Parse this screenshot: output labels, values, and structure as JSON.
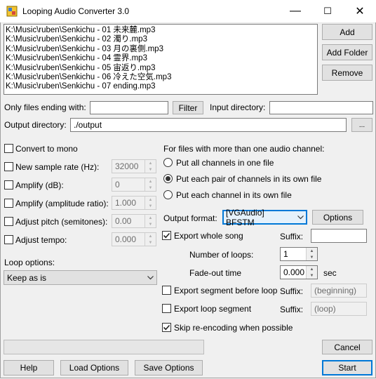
{
  "window": {
    "title": "Looping Audio Converter 3.0",
    "controls": {
      "minimize": "—",
      "maximize": "☐",
      "close": "✕"
    }
  },
  "files": [
    "K:\\Music\\ruben\\Senkichu - 01 未来麓.mp3",
    "K:\\Music\\ruben\\Senkichu - 02 濁り.mp3",
    "K:\\Music\\ruben\\Senkichu - 03 月の裏側.mp3",
    "K:\\Music\\ruben\\Senkichu - 04 霊界.mp3",
    "K:\\Music\\ruben\\Senkichu - 05 宙返り.mp3",
    "K:\\Music\\ruben\\Senkichu - 06 冷えた空気.mp3",
    "K:\\Music\\ruben\\Senkichu - 07 ending.mp3"
  ],
  "buttons": {
    "add": "Add",
    "add_folder": "Add Folder",
    "remove": "Remove",
    "filter": "Filter",
    "browse": "...",
    "options": "Options",
    "cancel": "Cancel",
    "help": "Help",
    "load_options": "Load Options",
    "save_options": "Save Options",
    "start": "Start"
  },
  "filter": {
    "label": "Only files ending with:",
    "value": "",
    "input_dir_label": "Input directory:",
    "input_dir_value": ""
  },
  "output": {
    "label": "Output directory:",
    "value": "./output"
  },
  "left_options": {
    "convert_mono": {
      "label": "Convert to mono",
      "checked": false
    },
    "sample_rate": {
      "label": "New sample rate (Hz):",
      "checked": false,
      "value": "32000"
    },
    "amplify_db": {
      "label": "Amplify (dB):",
      "checked": false,
      "value": "0"
    },
    "amplify_ratio": {
      "label": "Amplify (amplitude ratio):",
      "checked": false,
      "value": "1.000"
    },
    "pitch": {
      "label": "Adjust pitch (semitones):",
      "checked": false,
      "value": "0.00"
    },
    "tempo": {
      "label": "Adjust tempo:",
      "checked": false,
      "value": "0.000"
    }
  },
  "loop": {
    "label": "Loop options:",
    "value": "Keep as is"
  },
  "channels": {
    "label": "For files with more than one audio channel:",
    "options": [
      {
        "label": "Put all channels in one file",
        "selected": false
      },
      {
        "label": "Put each pair of channels in its own file",
        "selected": true
      },
      {
        "label": "Put each channel in its own file",
        "selected": false
      }
    ]
  },
  "format": {
    "label": "Output format:",
    "value": "[VGAudio] BFSTM"
  },
  "export_whole": {
    "label": "Export whole song",
    "checked": true,
    "suffix_label": "Suffix:",
    "suffix_value": ""
  },
  "loops": {
    "label": "Number of loops:",
    "value": "1"
  },
  "fade": {
    "label": "Fade-out time",
    "value": "0.000",
    "unit": "sec"
  },
  "export_before": {
    "label": "Export segment before loop",
    "checked": false,
    "suffix_label": "Suffix:",
    "suffix_value": "(beginning)"
  },
  "export_loop": {
    "label": "Export loop segment",
    "checked": false,
    "suffix_label": "Suffix:",
    "suffix_value": "(loop)"
  },
  "skip": {
    "label": "Skip re-encoding when possible",
    "checked": true
  },
  "progress": 0
}
